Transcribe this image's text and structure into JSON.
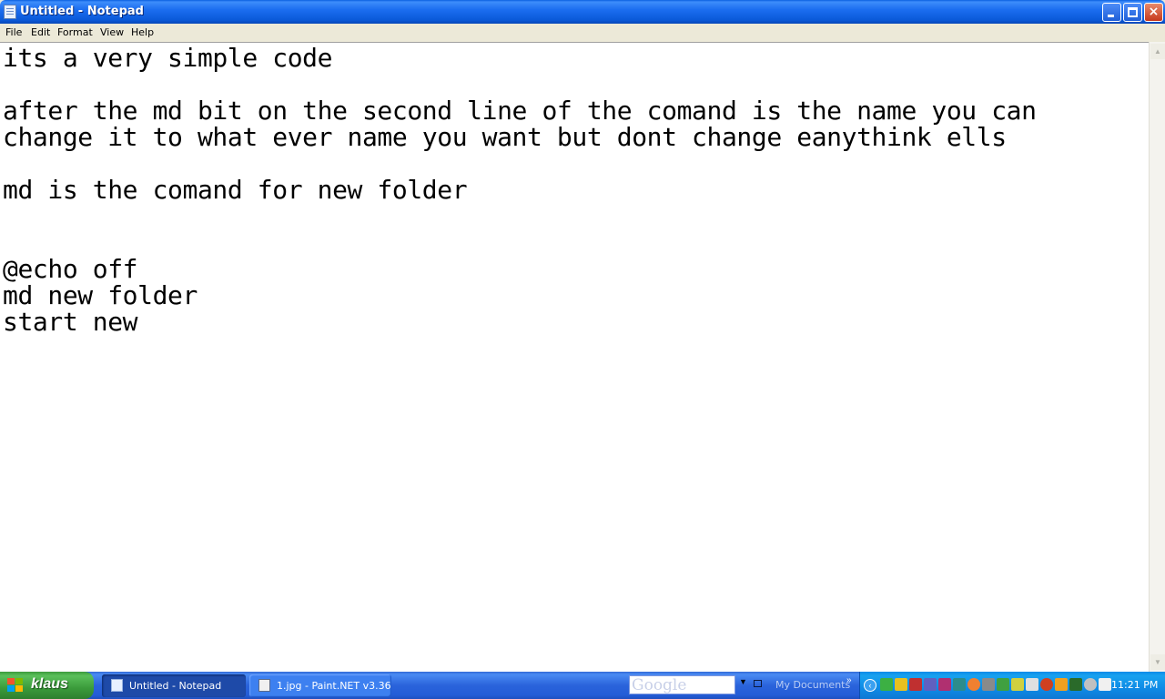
{
  "window": {
    "title": "Untitled - Notepad",
    "controls": {
      "minimize": "minimize",
      "maximize": "restore",
      "close": "×"
    }
  },
  "menu": {
    "items": [
      "File",
      "Edit",
      "Format",
      "View",
      "Help"
    ]
  },
  "editor": {
    "content": "its a very simple code\n\nafter the md bit on the second line of the comand is the name you can\nchange it to what ever name you want but dont change eanythink ells\n\nmd is the comand for new folder\n\n\n@echo off\nmd new folder\nstart new"
  },
  "taskbar": {
    "start_label": "klaus",
    "tasks": [
      {
        "label": "Untitled - Notepad",
        "active": true,
        "icon": "notepad-icon"
      },
      {
        "label": "1.jpg - Paint.NET v3.36",
        "active": false,
        "icon": "paintnet-icon"
      }
    ],
    "search_logo": "Google",
    "my_documents": "My Documents",
    "chevron": "»",
    "clock": "11:21 PM"
  },
  "colors": {
    "titlebar": "#0a59d8",
    "taskbar": "#245dd7",
    "start": "#3b9b3b",
    "tray": "#0f8be6"
  }
}
